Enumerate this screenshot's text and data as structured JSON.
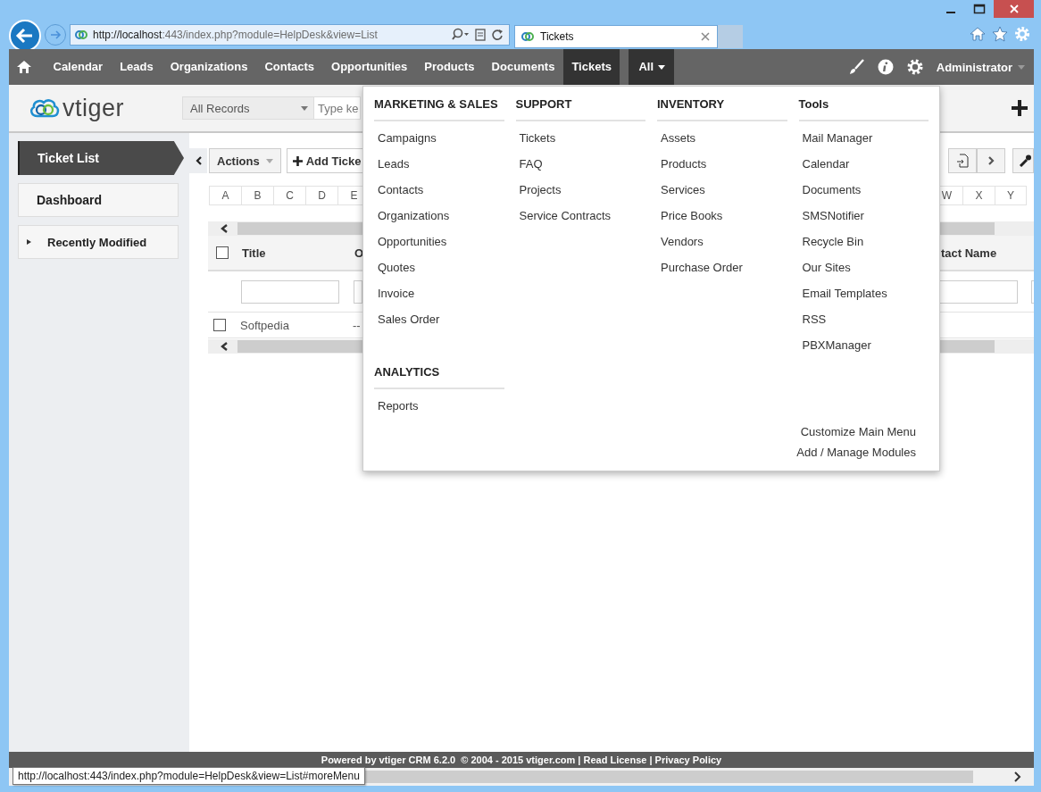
{
  "browser": {
    "address_host": "http://localhost",
    "address_rest": ":443/index.php?module=HelpDesk&view=List",
    "tab_title": "Tickets",
    "status_url": "http://localhost:443/index.php?module=HelpDesk&view=List#moreMenu"
  },
  "nav": {
    "items": [
      {
        "label": "Calendar",
        "selected": false
      },
      {
        "label": "Leads",
        "selected": false
      },
      {
        "label": "Organizations",
        "selected": false
      },
      {
        "label": "Contacts",
        "selected": false
      },
      {
        "label": "Opportunities",
        "selected": false
      },
      {
        "label": "Products",
        "selected": false
      },
      {
        "label": "Documents",
        "selected": false
      },
      {
        "label": "Tickets",
        "selected": true
      }
    ],
    "more": {
      "label": "All",
      "expanded": true
    },
    "user": "Administrator"
  },
  "header": {
    "logo": "vtiger",
    "filter": "All Records",
    "search_placeholder": "Type ke"
  },
  "sidebar": {
    "items": [
      {
        "label": "Ticket List",
        "selected": true
      },
      {
        "label": "Dashboard",
        "selected": false
      }
    ],
    "recent": {
      "label": "Recently Modified",
      "expanded": false
    }
  },
  "toolbar": {
    "actions": "Actions",
    "add": "Add Ticke"
  },
  "alphabet": {
    "left": [
      "A",
      "B",
      "C",
      "D",
      "E"
    ],
    "right": [
      "W",
      "X",
      "Y"
    ]
  },
  "table": {
    "select_all": {
      "checked": false
    },
    "columns_left": [
      "Title",
      "O"
    ],
    "column_right": "tact Name",
    "rows": [
      {
        "checked": false,
        "cells": [
          "Softpedia",
          "--"
        ]
      }
    ]
  },
  "menu": {
    "columns": [
      {
        "sections": [
          {
            "title": "MARKETING & SALES",
            "items": [
              "Campaigns",
              "Leads",
              "Contacts",
              "Organizations",
              "Opportunities",
              "Quotes",
              "Invoice",
              "Sales Order"
            ]
          },
          {
            "title": "ANALYTICS",
            "items": [
              "Reports"
            ]
          }
        ]
      },
      {
        "sections": [
          {
            "title": "SUPPORT",
            "items": [
              "Tickets",
              "FAQ",
              "Projects",
              "Service Contracts"
            ]
          }
        ]
      },
      {
        "sections": [
          {
            "title": "INVENTORY",
            "items": [
              "Assets",
              "Products",
              "Services",
              "Price Books",
              "Vendors",
              "Purchase Order"
            ]
          }
        ]
      },
      {
        "sections": [
          {
            "title": "Tools",
            "items": [
              "Mail Manager",
              "Calendar",
              "Documents",
              "SMSNotifier",
              "Recycle Bin",
              "Our Sites",
              "Email Templates",
              "RSS",
              "PBXManager"
            ]
          }
        ]
      }
    ],
    "links": [
      "Customize Main Menu",
      "Add / Manage Modules"
    ]
  },
  "footer": {
    "text": "Powered by vtiger CRM 6.2.0  © 2004 - 2015 ",
    "links": [
      "vtiger.com",
      "Read License",
      "Privacy Policy"
    ],
    "separator": "|"
  }
}
